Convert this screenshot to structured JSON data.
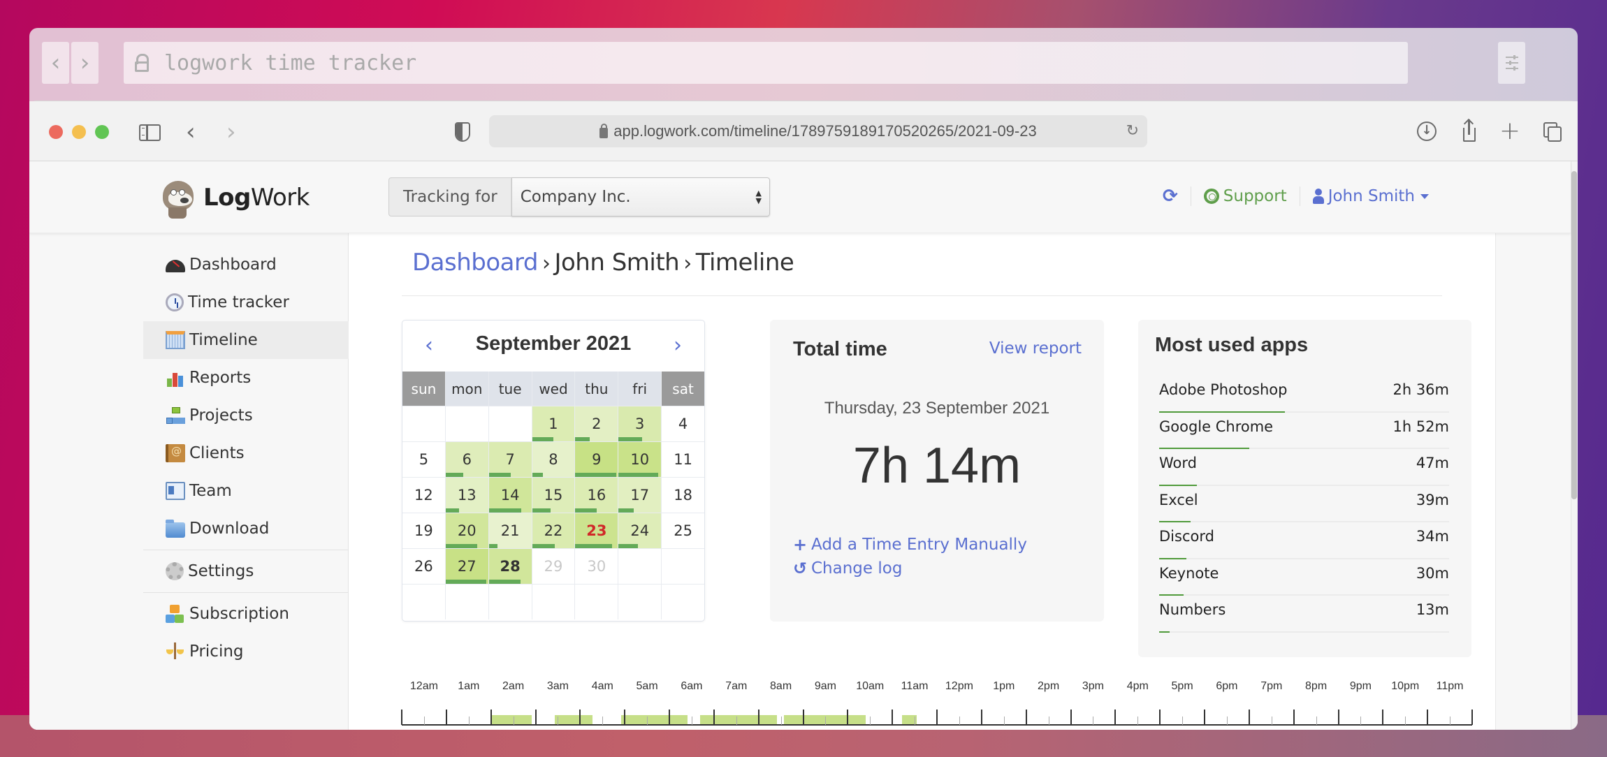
{
  "outer_bar": {
    "search_text": "logwork time tracker",
    "back_label": "‹",
    "forward_label": "›"
  },
  "browser": {
    "url": "app.logwork.com/timeline/1789759189170520265/2021-09-23",
    "back_icon": "‹",
    "forward_icon": "›",
    "reload_icon": "↻",
    "download_icon": "↓",
    "new_tab_icon": "+"
  },
  "header": {
    "logo_bold": "Log",
    "logo_regular": "Work",
    "tracking_label": "Tracking for",
    "tracking_value": "Company Inc.",
    "updown_icon": "▲▼",
    "sync_icon": "⟳",
    "support_label": "Support",
    "user_label": "John Smith"
  },
  "sidebar": {
    "items": [
      {
        "label": "Dashboard",
        "icon": "dashboard-gauge-icon",
        "active": false
      },
      {
        "label": "Time tracker",
        "icon": "clock-icon",
        "active": false
      },
      {
        "label": "Timeline",
        "icon": "calendar-icon",
        "active": true
      },
      {
        "label": "Reports",
        "icon": "bar-chart-icon",
        "active": false
      },
      {
        "label": "Projects",
        "icon": "hierarchy-icon",
        "active": false
      },
      {
        "label": "Clients",
        "icon": "address-book-icon",
        "active": false
      },
      {
        "label": "Team",
        "icon": "id-card-icon",
        "active": false
      },
      {
        "label": "Download",
        "icon": "folder-icon",
        "active": false
      },
      {
        "label": "Settings",
        "icon": "gear-icon",
        "active": false
      },
      {
        "label": "Subscription",
        "icon": "blocks-icon",
        "active": false
      },
      {
        "label": "Pricing",
        "icon": "scales-icon",
        "active": false
      }
    ]
  },
  "breadcrumb": {
    "items": [
      "Dashboard",
      "John Smith",
      "Timeline"
    ],
    "separator": "›"
  },
  "calendar": {
    "title": "September 2021",
    "prev_icon": "‹",
    "next_icon": "›",
    "weekdays": [
      "sun",
      "mon",
      "tue",
      "wed",
      "thu",
      "fri",
      "sat"
    ],
    "weekend_indices": [
      0,
      6
    ],
    "first_weekday": 3,
    "days_in_month": 30,
    "today": 23,
    "selected_bold": 28,
    "future_days": [
      29,
      30
    ],
    "activity": {
      "1": 0.5,
      "2": 0.33,
      "3": 0.55,
      "6": 0.42,
      "7": 0.52,
      "8": 0.26,
      "9": 0.97,
      "10": 0.93,
      "13": 0.32,
      "14": 0.76,
      "15": 0.44,
      "16": 0.5,
      "17": 0.36,
      "20": 0.75,
      "21": 0.21,
      "22": 0.54,
      "23": 0.87,
      "24": 0.45,
      "27": 0.96,
      "28": 0.75
    },
    "accent_bar_color": "#63aa58",
    "today_color": "#d02828"
  },
  "total_time": {
    "title": "Total time",
    "view_report_label": "View report",
    "date": "Thursday, 23 September 2021",
    "total": "7h 14m",
    "add_entry_label": "Add a Time Entry Manually",
    "add_icon": "+",
    "change_log_label": "Change log",
    "history_icon": "↺"
  },
  "most_used_apps": {
    "title": "Most used apps",
    "apps": [
      {
        "name": "Adobe Photoshop",
        "time": "2h 36m",
        "minutes": 156
      },
      {
        "name": "Google Chrome",
        "time": "1h 52m",
        "minutes": 112
      },
      {
        "name": "Word",
        "time": "47m",
        "minutes": 47
      },
      {
        "name": "Excel",
        "time": "39m",
        "minutes": 39
      },
      {
        "name": "Discord",
        "time": "34m",
        "minutes": 34
      },
      {
        "name": "Keynote",
        "time": "30m",
        "minutes": 30
      },
      {
        "name": "Numbers",
        "time": "13m",
        "minutes": 13
      }
    ]
  },
  "timeline": {
    "hour_labels": [
      "12am",
      "1am",
      "2am",
      "3am",
      "4am",
      "5am",
      "6am",
      "7am",
      "8am",
      "9am",
      "10am",
      "11am",
      "12pm",
      "1pm",
      "2pm",
      "3pm",
      "4pm",
      "5pm",
      "6pm",
      "7pm",
      "8pm",
      "9pm",
      "10pm",
      "11pm"
    ],
    "segments": [
      {
        "start": "2:00",
        "end": "2:55"
      },
      {
        "start": "3:26",
        "end": "4:17"
      },
      {
        "start": "4:55",
        "end": "6:24"
      },
      {
        "start": "6:41",
        "end": "8:25"
      },
      {
        "start": "8:34",
        "end": "10:24"
      },
      {
        "start": "11:13",
        "end": "11:33"
      }
    ],
    "active_color": "#c6df88"
  }
}
